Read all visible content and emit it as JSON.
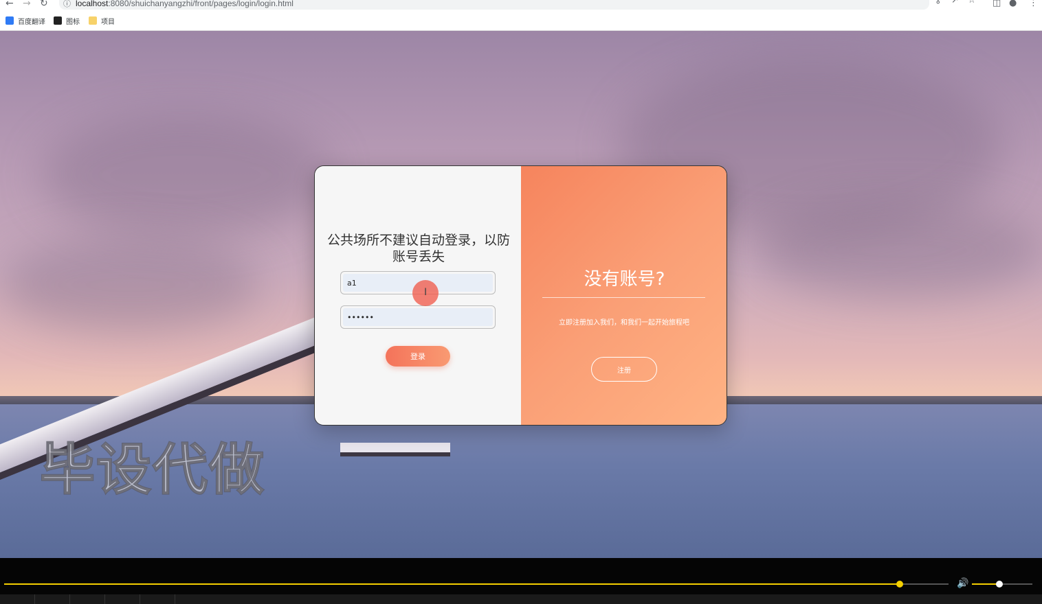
{
  "browser": {
    "url_host": "localhost",
    "url_path": ":8080/shuichanyangzhi/front/pages/login/login.html",
    "icons": [
      "back-arrow-icon",
      "forward-arrow-icon",
      "reload-icon",
      "key-icon",
      "share-icon",
      "star-icon",
      "sidebar-icon",
      "profile-icon",
      "kebab-menu-icon"
    ],
    "bookmarks": [
      {
        "label": "百度翻译",
        "icon": "baidu-translate-icon",
        "color": "#2f7bf5"
      },
      {
        "label": "图标",
        "icon": "image-icon",
        "color": "#222222"
      },
      {
        "label": "项目",
        "icon": "folder-icon",
        "color": "#f7d26a"
      }
    ]
  },
  "login": {
    "title": "公共场所不建议自动登录，以防账号丢失",
    "username_value": "a1",
    "password_value": "••••••",
    "login_button": "登录"
  },
  "register": {
    "title": "没有账号?",
    "text": "立即注册加入我们，和我们一起开始旅程吧",
    "register_button": "注册"
  },
  "watermark": "毕设代做",
  "player": {
    "progress": 0.948,
    "volume": 0.45,
    "accent_color": "#f5d000"
  }
}
